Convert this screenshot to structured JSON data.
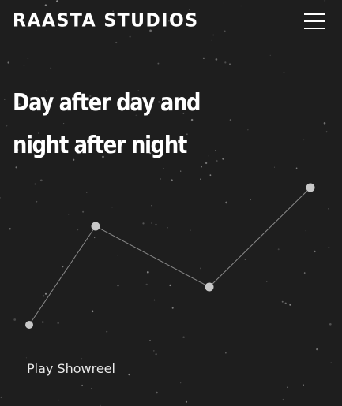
{
  "brand": {
    "logo_text": "RAASTA STUDIOS"
  },
  "header": {
    "menu_icon": "hamburger-menu-icon"
  },
  "hero": {
    "headline_line1": "Day after day and",
    "headline_line2": "night after night",
    "cta_label": "Play Showreel"
  },
  "colors": {
    "background": "#1e1e1e",
    "text": "#ffffff",
    "constellation_node": "#c8c8c8",
    "constellation_line": "#8a8a8a"
  }
}
